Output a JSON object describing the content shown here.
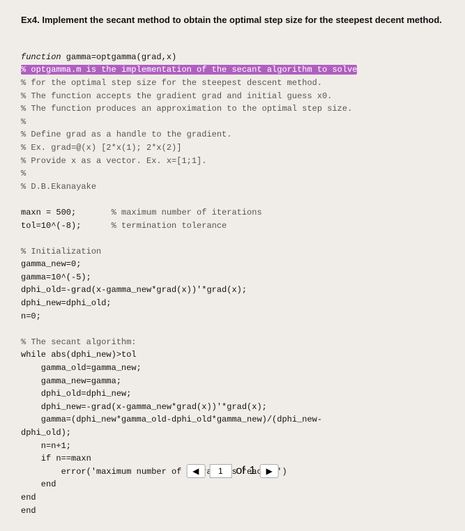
{
  "header": {
    "title": "Ex4. Implement the secant method to obtain the optimal step size for the steepest decent method."
  },
  "code": {
    "lines": [
      {
        "id": 1,
        "text": "function gamma=optgamma(grad,x)",
        "type": "code"
      },
      {
        "id": 2,
        "text": "% optgamma.m is the implementation of the secant algorithm to solve",
        "type": "highlight"
      },
      {
        "id": 3,
        "text": "% for the optimal step size for the steepest descent method.",
        "type": "comment"
      },
      {
        "id": 4,
        "text": "% The function accepts the gradient grad and initial guess x0.",
        "type": "comment"
      },
      {
        "id": 5,
        "text": "% The function produces an approximation to the optimal step size.",
        "type": "comment"
      },
      {
        "id": 6,
        "text": "%",
        "type": "comment"
      },
      {
        "id": 7,
        "text": "% Define grad as a handle to the gradient.",
        "type": "comment"
      },
      {
        "id": 8,
        "text": "% Ex. grad=@(x) [2*x(1); 2*x(2)]",
        "type": "comment"
      },
      {
        "id": 9,
        "text": "% Provide x as a vector. Ex. x=[1;1].",
        "type": "comment"
      },
      {
        "id": 10,
        "text": "%",
        "type": "comment"
      },
      {
        "id": 11,
        "text": "% D.B.Ekanayake",
        "type": "comment"
      },
      {
        "id": 12,
        "text": "",
        "type": "blank"
      },
      {
        "id": 13,
        "text": "",
        "type": "blank"
      },
      {
        "id": 14,
        "text": "maxn = 500;       % maximum number of iterations",
        "type": "code"
      },
      {
        "id": 15,
        "text": "tol=10^(-8);      % termination tolerance",
        "type": "code"
      },
      {
        "id": 16,
        "text": "",
        "type": "blank"
      },
      {
        "id": 17,
        "text": "% Initialization",
        "type": "comment"
      },
      {
        "id": 18,
        "text": "gamma_new=0;",
        "type": "code"
      },
      {
        "id": 19,
        "text": "gamma=10^(-5);",
        "type": "code"
      },
      {
        "id": 20,
        "text": "dphi_old=-grad(x-gamma_new*grad(x))'*grad(x);",
        "type": "code"
      },
      {
        "id": 21,
        "text": "dphi_new=dphi_old;",
        "type": "code"
      },
      {
        "id": 22,
        "text": "n=0;",
        "type": "code"
      },
      {
        "id": 23,
        "text": "",
        "type": "blank"
      },
      {
        "id": 24,
        "text": "% The secant algorithm:",
        "type": "comment"
      },
      {
        "id": 25,
        "text": "while abs(dphi_new)>tol",
        "type": "code"
      },
      {
        "id": 26,
        "text": "    gamma_old=gamma_new;",
        "type": "code"
      },
      {
        "id": 27,
        "text": "    gamma_new=gamma;",
        "type": "code"
      },
      {
        "id": 28,
        "text": "    dphi_old=dphi_new;",
        "type": "code"
      },
      {
        "id": 29,
        "text": "    dphi_new=-grad(x-gamma_new*grad(x))'*grad(x);",
        "type": "code"
      },
      {
        "id": 30,
        "text": "    gamma=(dphi_new*gamma_old-dphi_old*gamma_new)/(dphi_new-",
        "type": "code"
      },
      {
        "id": 31,
        "text": "dphi_old);",
        "type": "code"
      },
      {
        "id": 32,
        "text": "    n=n+1;",
        "type": "code"
      },
      {
        "id": 33,
        "text": "    if n==maxn",
        "type": "code"
      },
      {
        "id": 34,
        "text": "        error('maximum number of iterations reached')",
        "type": "code"
      },
      {
        "id": 35,
        "text": "    end",
        "type": "code"
      },
      {
        "id": 36,
        "text": "end",
        "type": "code"
      },
      {
        "id": 37,
        "text": "end",
        "type": "code"
      }
    ]
  },
  "pagination": {
    "current": "1",
    "of_label": "of",
    "total": "1",
    "prev_label": "◀",
    "next_label": "▶"
  }
}
